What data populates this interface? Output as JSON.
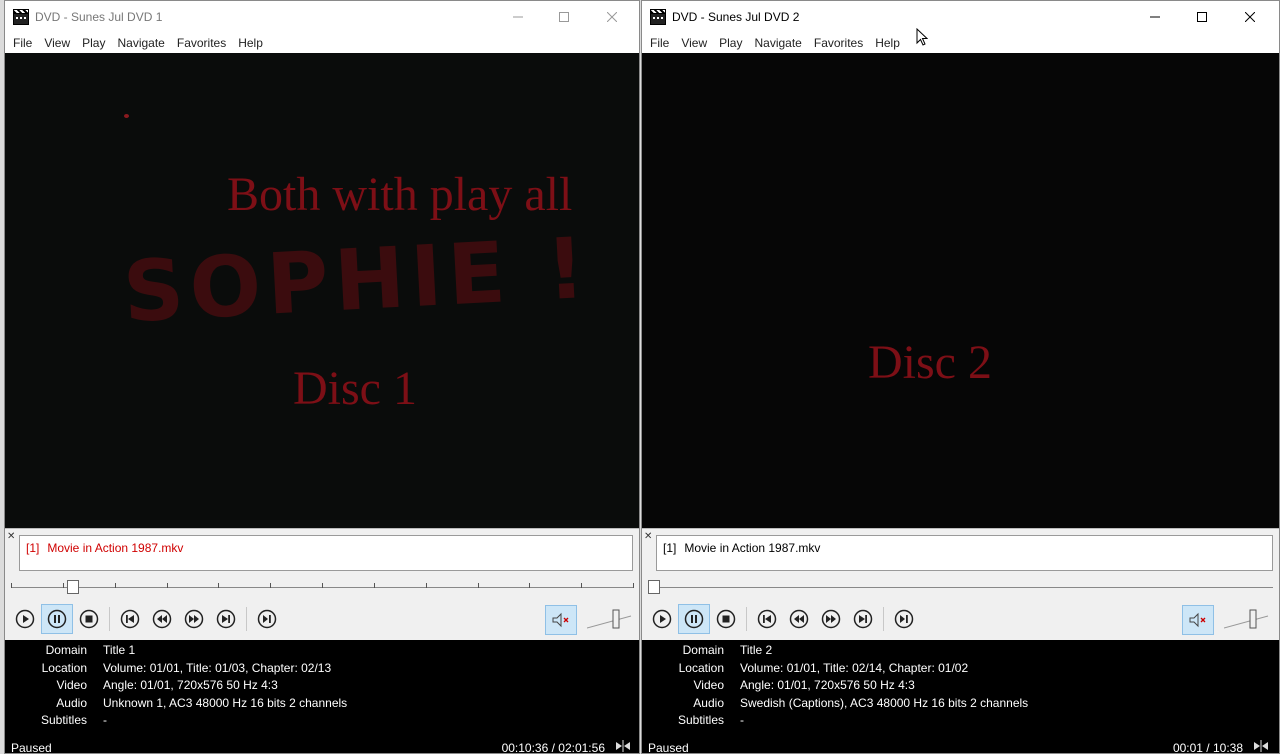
{
  "windows": [
    {
      "title": "DVD - Sunes Jul DVD 1",
      "menu": [
        "File",
        "View",
        "Play",
        "Navigate",
        "Favorites",
        "Help"
      ],
      "video": {
        "overlay_lines": [
          "Both with play all",
          "SOPHIE !",
          "Disc 1"
        ]
      },
      "playlist": {
        "index": "[1]",
        "name": "Movie in Action 1987.mkv"
      },
      "seek": {
        "position_fraction": 0.09
      },
      "info": [
        {
          "key": "Domain",
          "value": "Title 1"
        },
        {
          "key": "Location",
          "value": "Volume: 01/01, Title: 01/03, Chapter: 02/13"
        },
        {
          "key": "Video",
          "value": "Angle: 01/01, 720x576 50 Hz 4:3"
        },
        {
          "key": "Audio",
          "value": "Unknown 1, AC3 48000 Hz 16 bits 2 channels"
        },
        {
          "key": "Subtitles",
          "value": "-"
        }
      ],
      "status": {
        "state": "Paused",
        "time": "00:10:36 / 02:01:56"
      }
    },
    {
      "title": "DVD - Sunes Jul DVD 2",
      "menu": [
        "File",
        "View",
        "Play",
        "Navigate",
        "Favorites",
        "Help"
      ],
      "video": {
        "overlay_lines": [
          "Disc 2"
        ]
      },
      "playlist": {
        "index": "[1]",
        "name": "Movie in Action 1987.mkv"
      },
      "seek": {
        "position_fraction": 0.0
      },
      "info": [
        {
          "key": "Domain",
          "value": "Title 2"
        },
        {
          "key": "Location",
          "value": "Volume: 01/01, Title: 02/14, Chapter: 01/02"
        },
        {
          "key": "Video",
          "value": "Angle: 01/01, 720x576 50 Hz 4:3"
        },
        {
          "key": "Audio",
          "value": "Swedish (Captions), AC3 48000 Hz 16 bits 2 channels"
        },
        {
          "key": "Subtitles",
          "value": "-"
        }
      ],
      "status": {
        "state": "Paused",
        "time": "00:01 / 10:38"
      }
    }
  ],
  "icons": {
    "app": "clapperboard-icon",
    "minimize": "minimize-icon",
    "maximize": "maximize-icon",
    "close": "close-icon",
    "play": "play-icon",
    "pause": "pause-icon",
    "stop": "stop-icon",
    "prev": "skip-back-icon",
    "rewind": "rewind-icon",
    "forward": "fast-forward-icon",
    "next": "skip-forward-icon",
    "frame_step": "frame-step-icon",
    "mute": "mute-icon"
  },
  "colors": {
    "overlay_text": "#7d0f16",
    "active_button": "#cde6f7",
    "playing_item": "#d00000"
  }
}
